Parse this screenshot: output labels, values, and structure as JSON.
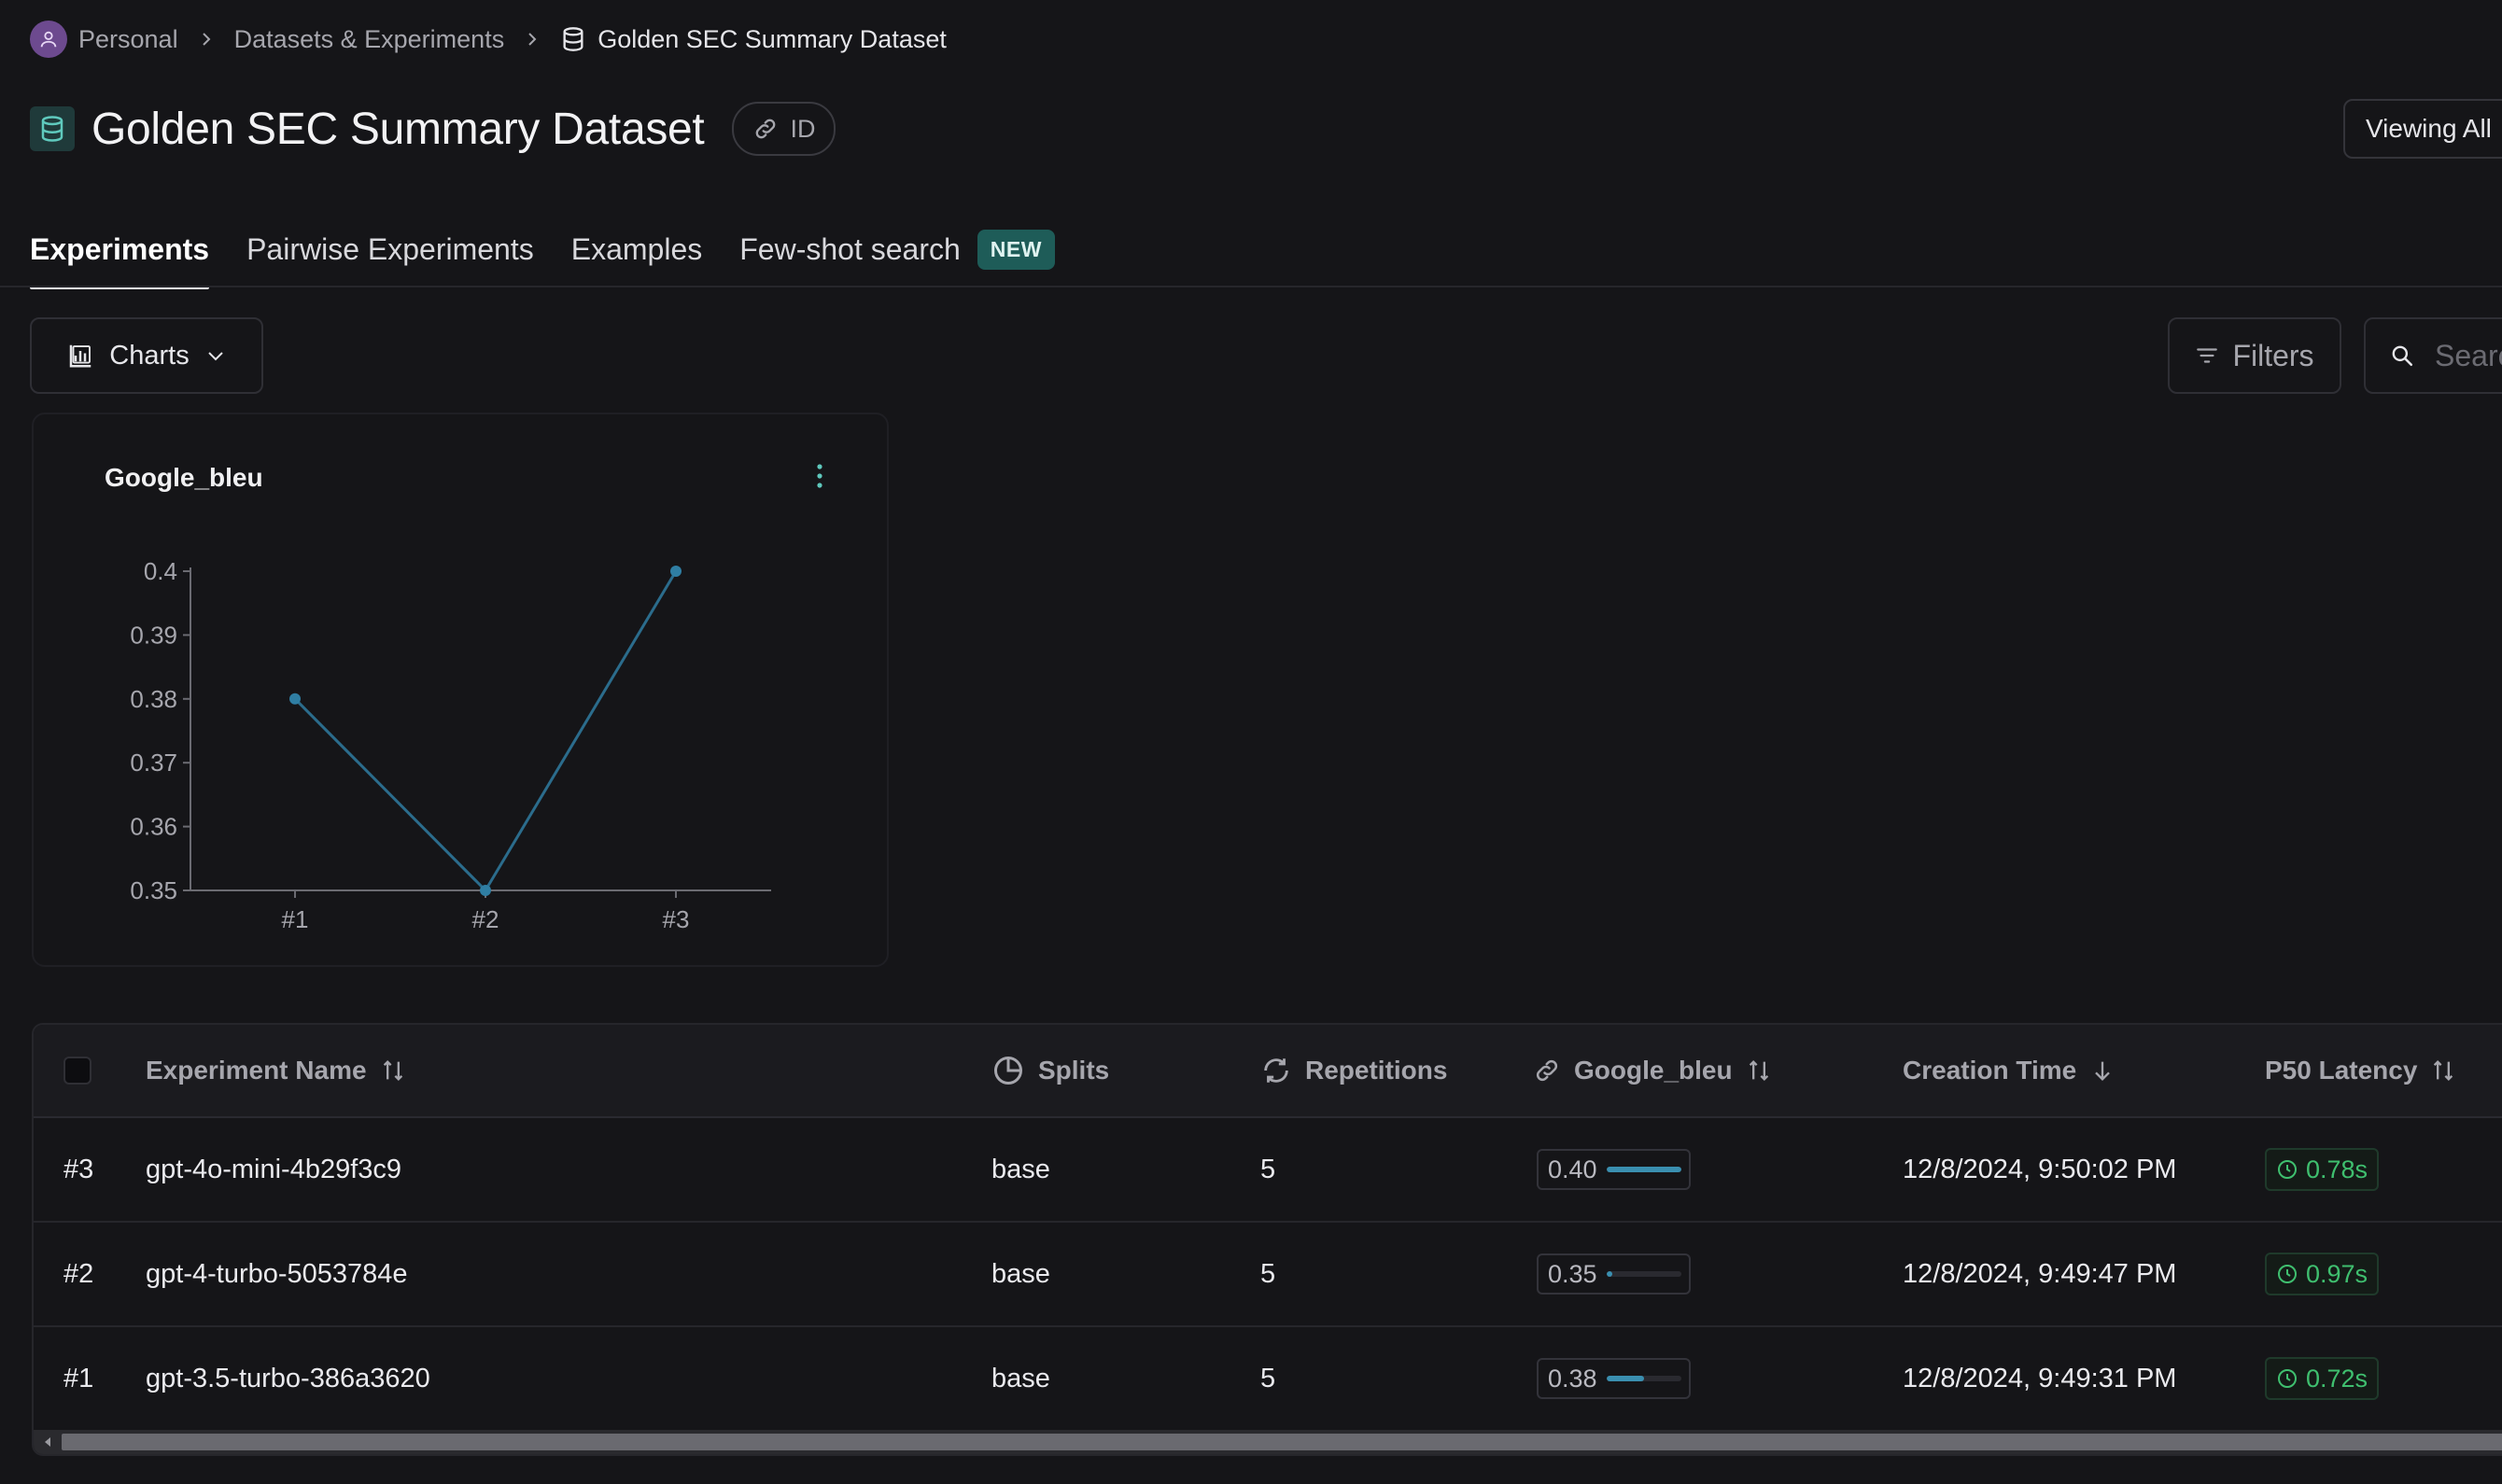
{
  "breadcrumb": {
    "items": [
      "Personal",
      "Datasets & Experiments",
      "Golden SEC Summary Dataset"
    ]
  },
  "header": {
    "title": "Golden SEC Summary Dataset",
    "id_label": "ID",
    "viewing_label": "Viewing All"
  },
  "tabs": [
    {
      "label": "Experiments",
      "active": true
    },
    {
      "label": "Pairwise Experiments",
      "active": false
    },
    {
      "label": "Examples",
      "active": false
    },
    {
      "label": "Few-shot search",
      "active": false,
      "badge": "NEW"
    }
  ],
  "toolbar": {
    "charts_label": "Charts",
    "filters_label": "Filters",
    "search_placeholder": "Search"
  },
  "chart_data": {
    "type": "line",
    "title": "Google_bleu",
    "categories": [
      "#1",
      "#2",
      "#3"
    ],
    "values": [
      0.38,
      0.35,
      0.4
    ],
    "ylim": [
      0.35,
      0.4
    ],
    "yticks": [
      0.35,
      0.36,
      0.37,
      0.38,
      0.39,
      0.4
    ],
    "ytick_labels": [
      "0.35",
      "0.36",
      "0.37",
      "0.38",
      "0.39",
      "0.4"
    ],
    "xlabel": "",
    "ylabel": "",
    "grid": false,
    "color": "#2b6c8c"
  },
  "table": {
    "columns": {
      "name": "Experiment Name",
      "splits": "Splits",
      "repetitions": "Repetitions",
      "metric": "Google_bleu",
      "created": "Creation Time",
      "latency": "P50 Latency"
    },
    "rows": [
      {
        "id": "#3",
        "name": "gpt-4o-mini-4b29f3c9",
        "split": "base",
        "repetitions": "5",
        "metric": "0.40",
        "metric_fraction": 1.0,
        "created": "12/8/2024, 9:50:02 PM",
        "latency": "0.78s"
      },
      {
        "id": "#2",
        "name": "gpt-4-turbo-5053784e",
        "split": "base",
        "repetitions": "5",
        "metric": "0.35",
        "metric_fraction": 0.08,
        "created": "12/8/2024, 9:49:47 PM",
        "latency": "0.97s"
      },
      {
        "id": "#1",
        "name": "gpt-3.5-turbo-386a3620",
        "split": "base",
        "repetitions": "5",
        "metric": "0.38",
        "metric_fraction": 0.5,
        "created": "12/8/2024, 9:49:31 PM",
        "latency": "0.72s"
      }
    ]
  },
  "colors": {
    "background": "#151518",
    "accent_teal": "#1e5c58",
    "line_series": "#2b6c8c",
    "latency_green": "#3fbf6f"
  }
}
